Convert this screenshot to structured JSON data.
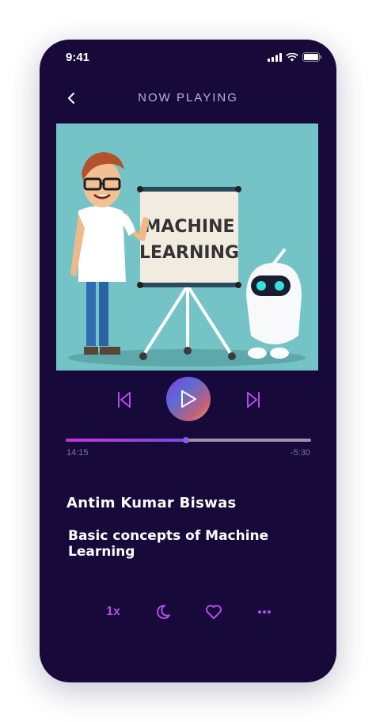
{
  "status": {
    "time": "9:41"
  },
  "header": {
    "title": "NOW PLAYING"
  },
  "artwork": {
    "board_line1": "MACHINE",
    "board_line2": "LEARNING"
  },
  "player": {
    "elapsed": "14:15",
    "remaining": "-5:30",
    "progress": 0.49
  },
  "track": {
    "author": "Antim Kumar Biswas",
    "title": "Basic concepts of Machine Learning"
  },
  "actions": {
    "speed": "1x"
  },
  "colors": {
    "background": "#170a3a",
    "accent": "#b14ee6",
    "artwork_bg": "#74c3c6"
  },
  "icons": [
    "back-chevron-icon",
    "previous-icon",
    "play-icon",
    "next-icon",
    "sleep-timer-icon",
    "heart-icon",
    "more-icon",
    "signal-icon",
    "wifi-icon",
    "battery-icon"
  ]
}
